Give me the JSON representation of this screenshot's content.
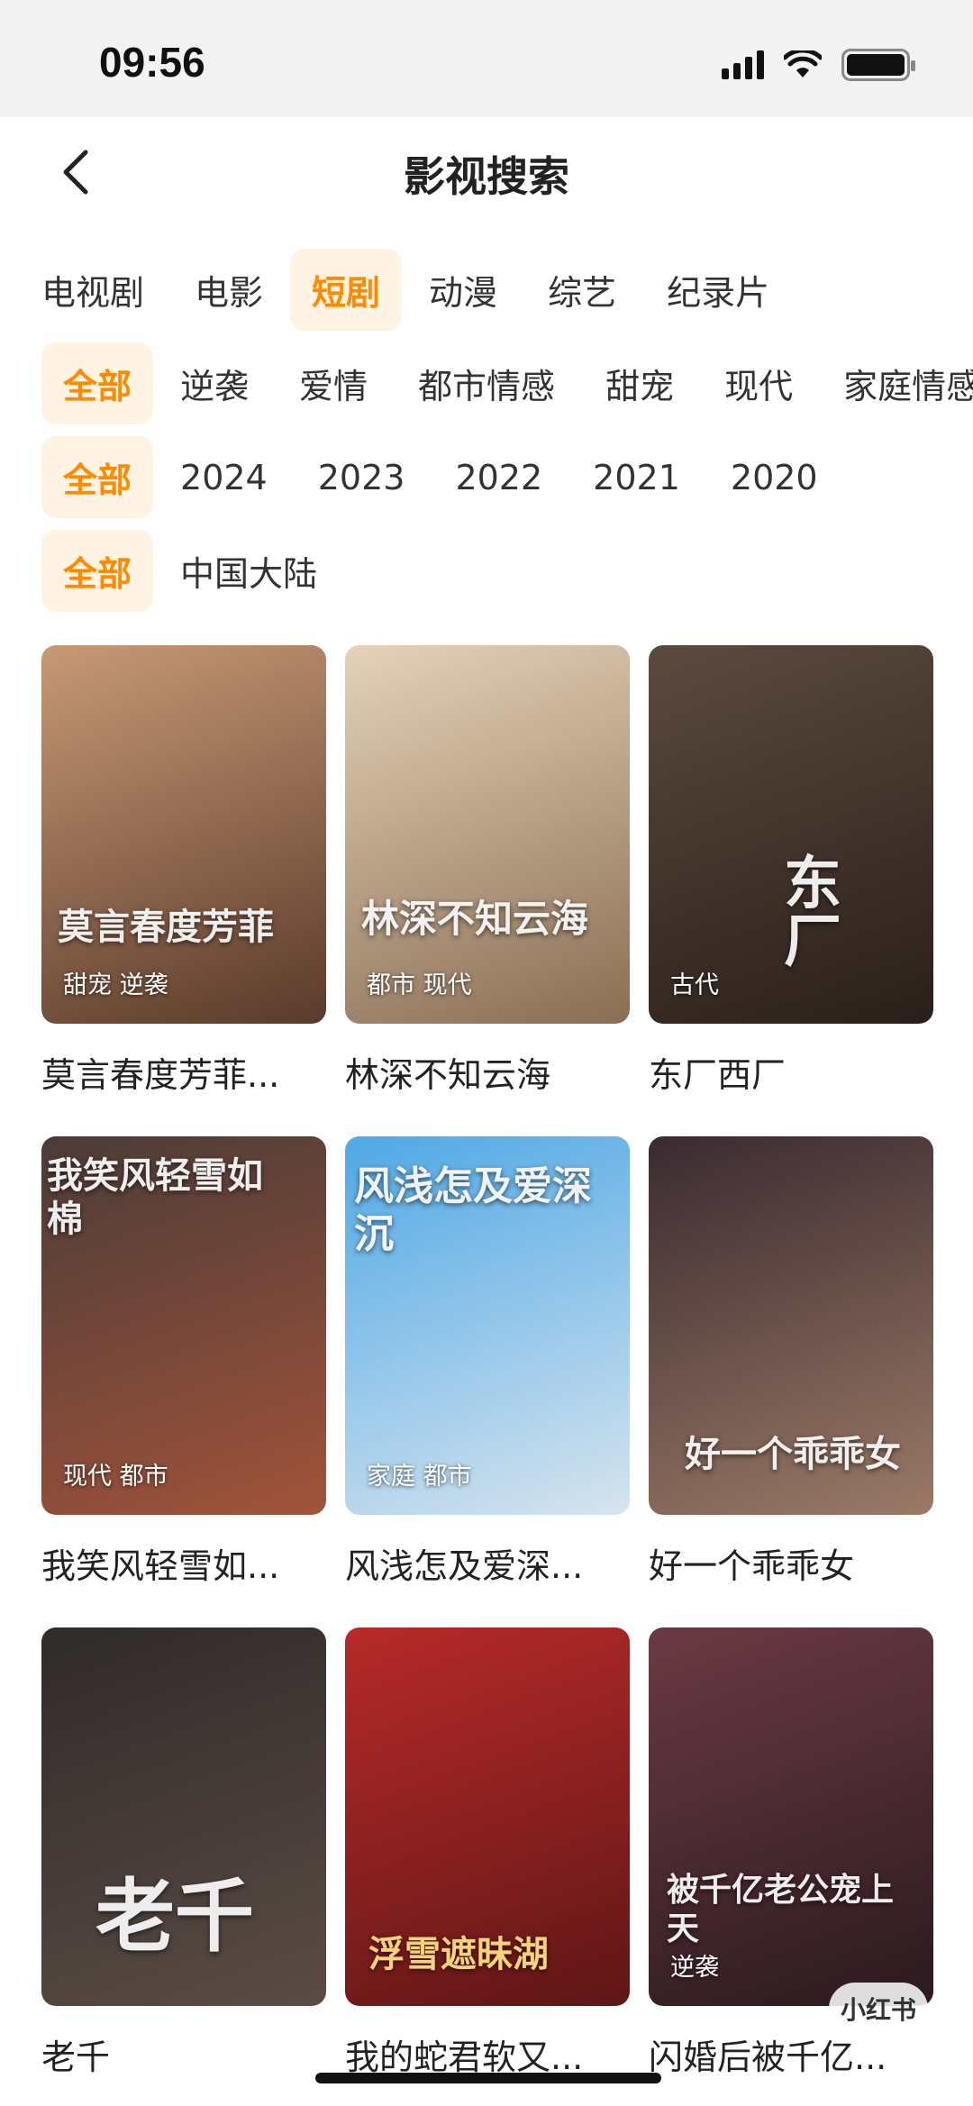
{
  "status": {
    "time": "09:56"
  },
  "nav": {
    "title": "影视搜索"
  },
  "categories": [
    "电视剧",
    "电影",
    "短剧",
    "动漫",
    "综艺",
    "纪录片"
  ],
  "genres": [
    "全部",
    "逆袭",
    "爱情",
    "都市情感",
    "甜宠",
    "现代",
    "家庭情感"
  ],
  "years": [
    "全部",
    "2024",
    "2023",
    "2022",
    "2021",
    "2020"
  ],
  "regions": [
    "全部",
    "中国大陆"
  ],
  "items": [
    {
      "title": "莫言春度芳菲...",
      "tags": "甜宠 逆袭",
      "poster_text": "莫言春度芳菲",
      "colors": [
        "#c79a76",
        "#5a3a2a"
      ]
    },
    {
      "title": "林深不知云海",
      "tags": "都市 现代",
      "poster_text": "林深不知云海",
      "colors": [
        "#e5d2b8",
        "#8a6e54"
      ]
    },
    {
      "title": "东厂西厂",
      "tags": "古代",
      "poster_text": "东厂",
      "colors": [
        "#5b4a3e",
        "#2b1f1a"
      ]
    },
    {
      "title": "我笑风轻雪如...",
      "tags": "现代 都市",
      "poster_text": "我笑风轻雪如棉",
      "colors": [
        "#4b3c38",
        "#a2533a"
      ]
    },
    {
      "title": "风浅怎及爱深...",
      "tags": "家庭 都市",
      "poster_text": "风浅怎及爱深沉",
      "colors": [
        "#4fa8e6",
        "#d6e4ee"
      ]
    },
    {
      "title": "好一个乖乖女",
      "tags": "",
      "poster_text": "好一个乖乖女",
      "colors": [
        "#3a2a30",
        "#9b7a66"
      ]
    },
    {
      "title": "老千",
      "tags": "",
      "poster_text": "老千",
      "colors": [
        "#2f2b2a",
        "#5b4c44"
      ]
    },
    {
      "title": "我的蛇君软又...",
      "tags": "",
      "poster_text": "浮雪遮昧湖",
      "colors": [
        "#b82a2a",
        "#5e1616"
      ]
    },
    {
      "title": "闪婚后被千亿...",
      "tags": "逆袭",
      "poster_text": "被千亿老公宠上天",
      "colors": [
        "#6b3a44",
        "#2a1a1e"
      ]
    }
  ],
  "watermark": "小红书"
}
